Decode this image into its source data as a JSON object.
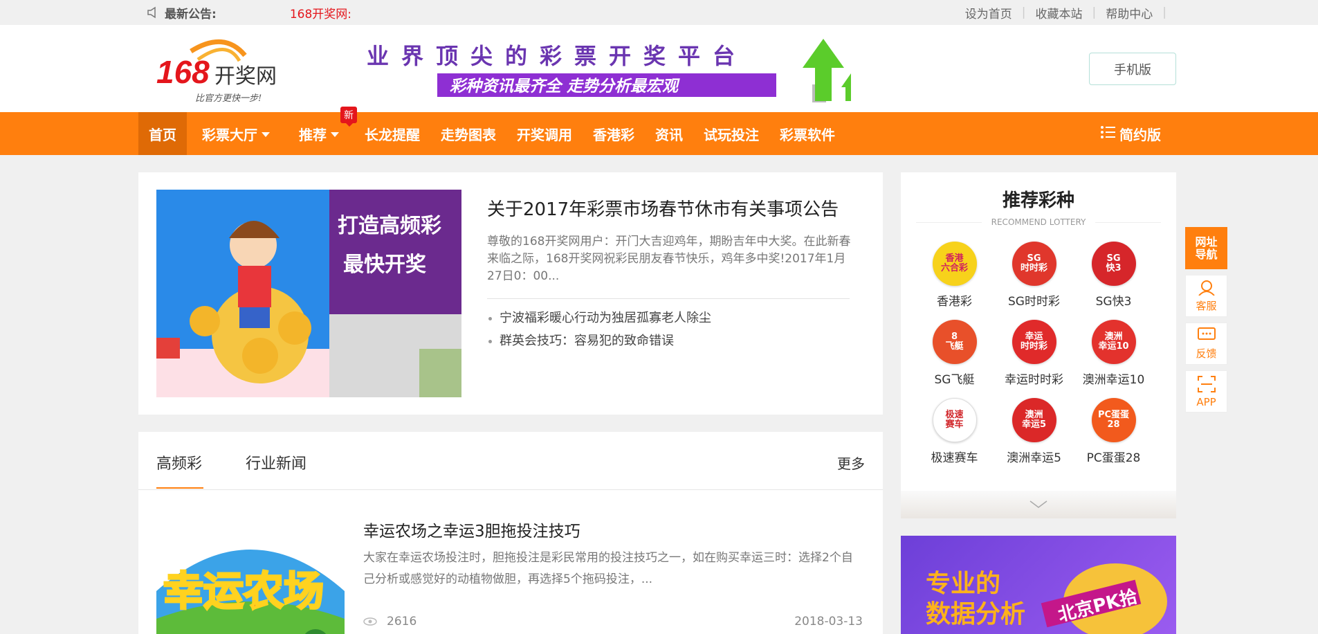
{
  "topbar": {
    "notice_label": "最新公告:",
    "notice_text": "168开奖网:",
    "links": [
      "设为首页",
      "收藏本站",
      "帮助中心"
    ]
  },
  "header": {
    "logo_text": "168开奖网",
    "logo_slogan": "比官方更快一步!",
    "banner_line1": "业界顶尖的彩票开奖平台",
    "banner_line2": "彩种资讯最齐全 走势分析最宏观",
    "mobile_button": "手机版"
  },
  "nav": {
    "items": [
      {
        "label": "首页"
      },
      {
        "label": "彩票大厅"
      },
      {
        "label": "推荐"
      },
      {
        "label": "长龙提醒"
      },
      {
        "label": "走势图表"
      },
      {
        "label": "开奖调用"
      },
      {
        "label": "香港彩"
      },
      {
        "label": "资讯"
      },
      {
        "label": "试玩投注"
      },
      {
        "label": "彩票软件"
      }
    ],
    "new_badge": "新",
    "simple_version": "简约版"
  },
  "feature": {
    "image_text1": "打造高频彩",
    "image_text2": "最快开奖",
    "title": "关于2017年彩票市场春节休市有关事项公告",
    "description": "尊敬的168开奖网用户：开门大吉迎鸡年，期盼吉年中大奖。在此新春来临之际，168开奖网祝彩民朋友春节快乐，鸡年多中奖!2017年1月27日0：00...",
    "list": [
      "宁波福彩暖心行动为独居孤寡老人除尘",
      "群英会技巧：容易犯的致命错误"
    ]
  },
  "news": {
    "tabs": [
      "高频彩",
      "行业新闻"
    ],
    "more": "更多",
    "article": {
      "title": "幸运农场之幸运3胆拖投注技巧",
      "description": "大家在幸运农场投注时，胆拖投注是彩民常用的投注技巧之一，如在购买幸运三时：选择2个自己分析或感觉好的动植物做胆，再选择5个拖码投注，...",
      "views": "2616",
      "date": "2018-03-13"
    }
  },
  "recommend": {
    "title": "推荐彩种",
    "subtitle": "RECOMMEND LOTTERY",
    "items": [
      {
        "label": "香港彩",
        "icon_text": "香港\n六合彩",
        "color": "#f7d21b"
      },
      {
        "label": "SG时时彩",
        "icon_text": "SG\n时时彩",
        "color": "#e0372c"
      },
      {
        "label": "SG快3",
        "icon_text": "SG\n快3",
        "color": "#d6262a"
      },
      {
        "label": "SG飞艇",
        "icon_text": "8\n飞艇",
        "color": "#e8502a"
      },
      {
        "label": "幸运时时彩",
        "icon_text": "幸运\n时时彩",
        "color": "#e02a2a"
      },
      {
        "label": "澳洲幸运10",
        "icon_text": "澳洲\n幸运10",
        "color": "#e3322d"
      },
      {
        "label": "极速赛车",
        "icon_text": "极速\n赛车",
        "color": "#ffffff"
      },
      {
        "label": "澳洲幸运5",
        "icon_text": "澳洲\n幸运5",
        "color": "#db2828"
      },
      {
        "label": "PC蛋蛋28",
        "icon_text": "PC蛋蛋\n28",
        "color": "#f25a1d"
      }
    ]
  },
  "ad": {
    "line1": "专业的",
    "line2": "数据分析",
    "badge": "北京PK拾"
  },
  "float_bar": {
    "items": [
      "网址导航",
      "客服",
      "反馈",
      "APP"
    ]
  },
  "colors": {
    "brand_orange": "#ff7f0e",
    "nav_active": "#df6a06",
    "notice_red": "#e4161c"
  }
}
